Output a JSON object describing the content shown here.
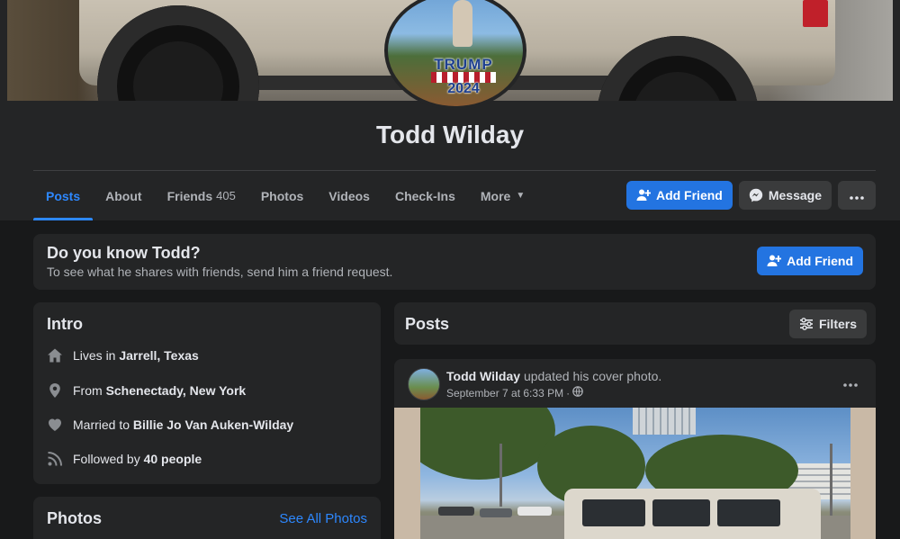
{
  "profile": {
    "name": "Todd Wilday",
    "avatar_sign": {
      "line1": "TRUMP",
      "line2": "2024"
    }
  },
  "tabs": [
    {
      "label": "Posts",
      "active": true
    },
    {
      "label": "About"
    },
    {
      "label": "Friends",
      "count": "405"
    },
    {
      "label": "Photos"
    },
    {
      "label": "Videos"
    },
    {
      "label": "Check-Ins"
    },
    {
      "label": "More",
      "icon": "caret-down-icon"
    }
  ],
  "header_actions": {
    "add_friend": "Add Friend",
    "message": "Message",
    "more_icon": "ellipsis-icon"
  },
  "know_banner": {
    "title": "Do you know Todd?",
    "subtitle": "To see what he shares with friends, send him a friend request.",
    "button": "Add Friend"
  },
  "intro": {
    "title": "Intro",
    "items": [
      {
        "icon": "home-icon",
        "prefix": "Lives in",
        "value": "Jarrell, Texas"
      },
      {
        "icon": "location-pin-icon",
        "prefix": "From",
        "value": "Schenectady, New York"
      },
      {
        "icon": "heart-icon",
        "prefix": "Married to",
        "value": "Billie Jo Van Auken-Wilday"
      },
      {
        "icon": "rss-feed-icon",
        "prefix": "Followed by",
        "value": "40 people"
      }
    ]
  },
  "photos_section": {
    "title": "Photos",
    "see_all": "See All Photos"
  },
  "posts_section": {
    "title": "Posts",
    "filters": "Filters"
  },
  "post": {
    "author": "Todd Wilday",
    "action": "updated his cover photo.",
    "timestamp": "September 7 at 6:33 PM",
    "separator": "·",
    "audience_icon": "globe-icon",
    "menu_icon": "ellipsis-icon"
  },
  "colors": {
    "background": "#18191a",
    "card": "#242526",
    "accent": "#2374e1",
    "link": "#2d88ff",
    "text_primary": "#e4e6eb",
    "text_secondary": "#b0b3b8"
  }
}
